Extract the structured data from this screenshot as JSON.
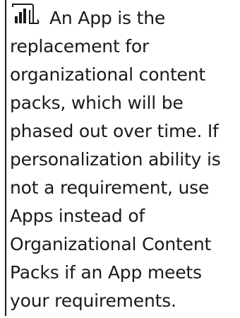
{
  "callout": {
    "icon": "power-bi-icon",
    "text": "An App is the replacement for organizational content packs, which will be phased out over time. If personalization ability is not a requirement, use Apps instead of Organizational Content Packs if an App meets your requirements."
  },
  "colors": {
    "text": "#1a1a1a",
    "rule": "#1a1a1a",
    "background": "#ffffff"
  }
}
